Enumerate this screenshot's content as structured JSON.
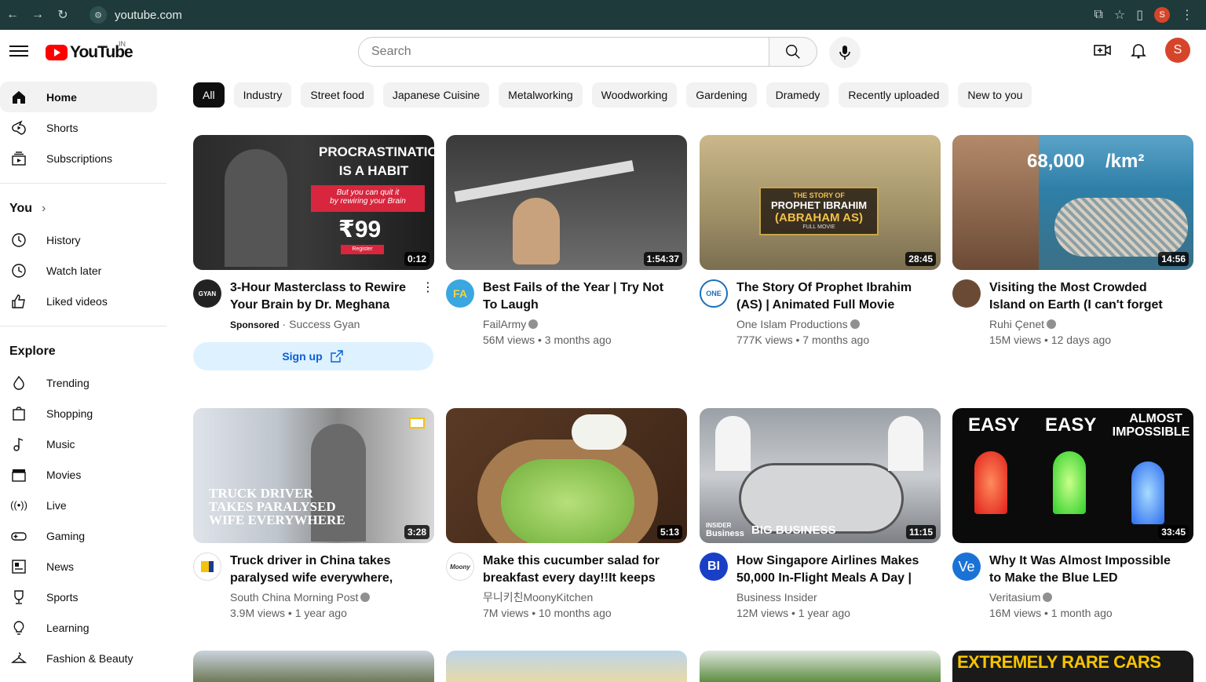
{
  "browser": {
    "url": "youtube.com",
    "profile_initial": "S"
  },
  "header": {
    "logo_text": "YouTube",
    "country_code": "IN",
    "search_placeholder": "Search",
    "avatar_initial": "S"
  },
  "sidebar": {
    "main": [
      {
        "label": "Home",
        "icon": "home-icon"
      },
      {
        "label": "Shorts",
        "icon": "shorts-icon"
      },
      {
        "label": "Subscriptions",
        "icon": "subscriptions-icon"
      }
    ],
    "you_heading": "You",
    "you": [
      {
        "label": "History",
        "icon": "history-icon"
      },
      {
        "label": "Watch later",
        "icon": "clock-icon"
      },
      {
        "label": "Liked videos",
        "icon": "thumbs-up-icon"
      }
    ],
    "explore_heading": "Explore",
    "explore": [
      {
        "label": "Trending",
        "icon": "flame-icon"
      },
      {
        "label": "Shopping",
        "icon": "bag-icon"
      },
      {
        "label": "Music",
        "icon": "music-note-icon"
      },
      {
        "label": "Movies",
        "icon": "clapper-icon"
      },
      {
        "label": "Live",
        "icon": "live-icon"
      },
      {
        "label": "Gaming",
        "icon": "gamepad-icon"
      },
      {
        "label": "News",
        "icon": "newspaper-icon"
      },
      {
        "label": "Sports",
        "icon": "trophy-icon"
      },
      {
        "label": "Learning",
        "icon": "lightbulb-icon"
      },
      {
        "label": "Fashion & Beauty",
        "icon": "hanger-icon"
      }
    ]
  },
  "chips": [
    "All",
    "Industry",
    "Street food",
    "Japanese Cuisine",
    "Metalworking",
    "Woodworking",
    "Gardening",
    "Dramedy",
    "Recently uploaded",
    "New to you"
  ],
  "videos": [
    {
      "title": "3-Hour Masterclass to Rewire Your Brain by Dr. Meghana Dikshit",
      "channel": "Success Gyan",
      "sponsored": "Sponsored",
      "duration": "0:12",
      "cta": "Sign up",
      "thumb_text": [
        "PROCRASTINATION",
        "IS A HABIT",
        "But you can quit it",
        "by rewiring your Brain",
        "₹99",
        "Register"
      ],
      "avatar_text": "GYAN"
    },
    {
      "title": "Best Fails of the Year | Try Not To Laugh",
      "channel": "FailArmy",
      "views": "56M views • 3 months ago",
      "duration": "1:54:37",
      "avatar_text": "FA"
    },
    {
      "title": "The Story Of Prophet Ibrahim (AS) | Animated Full Movie",
      "channel": "One Islam Productions",
      "views": "777K views • 7 months ago",
      "duration": "28:45",
      "thumb_text": [
        "THE STORY OF",
        "PROPHET IBRAHIM",
        "(ABRAHAM AS)",
        "FULL MOVIE"
      ],
      "avatar_text": "ONE"
    },
    {
      "title": "Visiting the Most Crowded Island on Earth (I can't forget what I...",
      "channel": "Ruhi Çenet",
      "views": "15M views • 12 days ago",
      "duration": "14:56",
      "thumb_text": [
        "68,000",
        "/km²"
      ],
      "avatar_text": ""
    },
    {
      "title": "Truck driver in China takes paralysed wife everywhere, even...",
      "channel": "South China Morning Post",
      "views": "3.9M views • 1 year ago",
      "duration": "3:28",
      "thumb_text": [
        "TRUCK DRIVER",
        "TAKES PARALYSED",
        "WIFE EVERYWHERE"
      ],
      "avatar_text": ""
    },
    {
      "title": "Make this cucumber salad for breakfast every day!!It keeps yo...",
      "channel": "무니키친MoonyKitchen",
      "views": "7M views • 10 months ago",
      "duration": "5:13",
      "avatar_text": "Moony"
    },
    {
      "title": "How Singapore Airlines Makes 50,000 In-Flight Meals A Day | Bi...",
      "channel": "Business Insider",
      "views": "12M views • 1 year ago",
      "duration": "11:15",
      "thumb_text": [
        "INSIDER",
        "Business",
        "BIG BUSINESS"
      ],
      "avatar_text": "BI"
    },
    {
      "title": "Why It Was Almost Impossible to Make the Blue LED",
      "channel": "Veritasium",
      "views": "16M views • 1 month ago",
      "duration": "33:45",
      "thumb_text": [
        "EASY",
        "EASY",
        "ALMOST",
        "IMPOSSIBLE"
      ],
      "avatar_text": "Ve"
    }
  ],
  "bottom_row_thumb_text": "EXTREMELY RARE CARS"
}
